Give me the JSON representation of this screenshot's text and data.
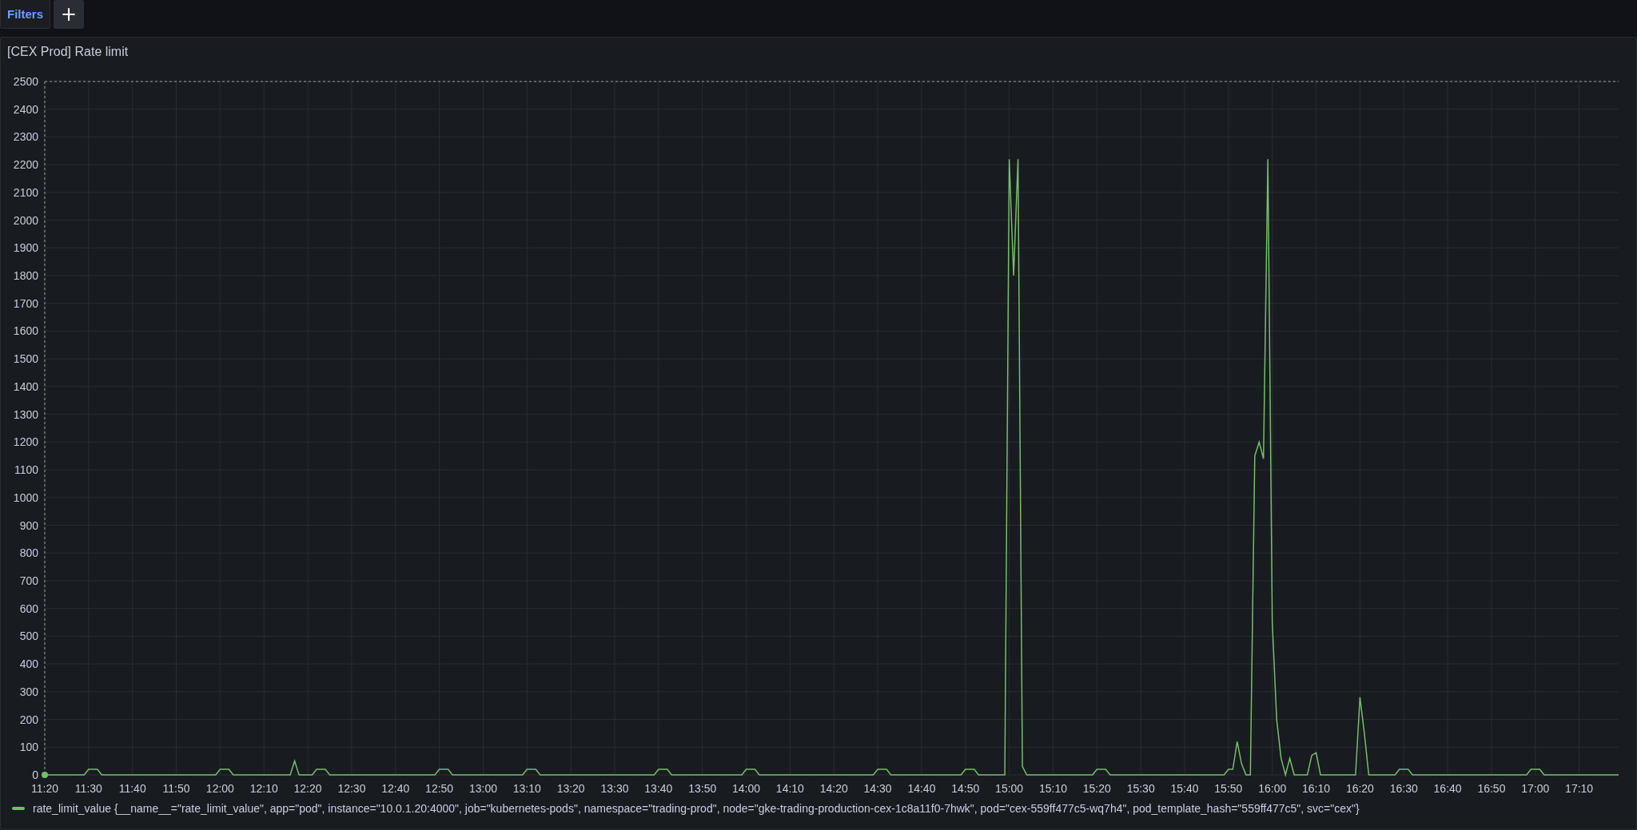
{
  "toolbar": {
    "filters_button": "Filters",
    "add_button": "+"
  },
  "panel": {
    "title": "[CEX Prod] Rate limit",
    "chart_data": {
      "type": "line",
      "grid": true,
      "ylim": [
        0,
        2500
      ],
      "yticks": [
        0,
        100,
        200,
        300,
        400,
        500,
        600,
        700,
        800,
        900,
        1000,
        1100,
        1200,
        1300,
        1400,
        1500,
        1600,
        1700,
        1800,
        1900,
        2000,
        2100,
        2200,
        2300,
        2400,
        2500
      ],
      "categories": [
        "11:20",
        null,
        null,
        null,
        null,
        null,
        null,
        null,
        null,
        null,
        "11:30",
        null,
        null,
        null,
        null,
        null,
        null,
        null,
        null,
        null,
        "11:40",
        null,
        null,
        null,
        null,
        null,
        null,
        null,
        null,
        null,
        "11:50",
        null,
        null,
        null,
        null,
        null,
        null,
        null,
        null,
        null,
        "12:00",
        null,
        null,
        null,
        null,
        null,
        null,
        null,
        null,
        null,
        "12:10",
        null,
        null,
        null,
        null,
        null,
        null,
        null,
        null,
        null,
        "12:20",
        null,
        null,
        null,
        null,
        null,
        null,
        null,
        null,
        null,
        "12:30",
        null,
        null,
        null,
        null,
        null,
        null,
        null,
        null,
        null,
        "12:40",
        null,
        null,
        null,
        null,
        null,
        null,
        null,
        null,
        null,
        "12:50",
        null,
        null,
        null,
        null,
        null,
        null,
        null,
        null,
        null,
        "13:00",
        null,
        null,
        null,
        null,
        null,
        null,
        null,
        null,
        null,
        "13:10",
        null,
        null,
        null,
        null,
        null,
        null,
        null,
        null,
        null,
        "13:20",
        null,
        null,
        null,
        null,
        null,
        null,
        null,
        null,
        null,
        "13:30",
        null,
        null,
        null,
        null,
        null,
        null,
        null,
        null,
        null,
        "13:40",
        null,
        null,
        null,
        null,
        null,
        null,
        null,
        null,
        null,
        "13:50",
        null,
        null,
        null,
        null,
        null,
        null,
        null,
        null,
        null,
        "14:00",
        null,
        null,
        null,
        null,
        null,
        null,
        null,
        null,
        null,
        "14:10",
        null,
        null,
        null,
        null,
        null,
        null,
        null,
        null,
        null,
        "14:20",
        null,
        null,
        null,
        null,
        null,
        null,
        null,
        null,
        null,
        "14:30",
        null,
        null,
        null,
        null,
        null,
        null,
        null,
        null,
        null,
        "14:40",
        null,
        null,
        null,
        null,
        null,
        null,
        null,
        null,
        null,
        "14:50",
        null,
        null,
        null,
        null,
        null,
        null,
        null,
        null,
        null,
        "15:00",
        null,
        null,
        null,
        null,
        null,
        null,
        null,
        null,
        null,
        "15:10",
        null,
        null,
        null,
        null,
        null,
        null,
        null,
        null,
        null,
        "15:20",
        null,
        null,
        null,
        null,
        null,
        null,
        null,
        null,
        null,
        "15:30",
        null,
        null,
        null,
        null,
        null,
        null,
        null,
        null,
        null,
        "15:40",
        null,
        null,
        null,
        null,
        null,
        null,
        null,
        null,
        null,
        "15:50",
        null,
        null,
        null,
        null,
        null,
        null,
        null,
        null,
        null,
        "16:00",
        null,
        null,
        null,
        null,
        null,
        null,
        null,
        null,
        null,
        "16:10",
        null,
        null,
        null,
        null,
        null,
        null,
        null,
        null,
        null,
        "16:20",
        null,
        null,
        null,
        null,
        null,
        null,
        null,
        null,
        null,
        "16:30",
        null,
        null,
        null,
        null,
        null,
        null,
        null,
        null,
        null,
        "16:40",
        null,
        null,
        null,
        null,
        null,
        null,
        null,
        null,
        null,
        "16:50",
        null,
        null,
        null,
        null,
        null,
        null,
        null,
        null,
        null,
        "17:00",
        null,
        null,
        null,
        null,
        null,
        null,
        null,
        null,
        null,
        "17:10",
        null,
        null,
        null,
        null,
        null,
        null,
        null,
        null,
        null
      ],
      "series": [
        {
          "name": "rate_limit_value {__name__=\"rate_limit_value\", app=\"pod\", instance=\"10.0.1.20:4000\", job=\"kubernetes-pods\", namespace=\"trading-prod\", node=\"gke-trading-production-cex-1c8a11f0-7hwk\", pod=\"cex-559ff477c5-wq7h4\", pod_template_hash=\"559ff477c5\", svc=\"cex\"}",
          "color": "#73bf69",
          "values": [
            0,
            0,
            0,
            0,
            0,
            0,
            0,
            0,
            0,
            0,
            20,
            20,
            20,
            0,
            0,
            0,
            0,
            0,
            0,
            0,
            0,
            0,
            0,
            0,
            0,
            0,
            0,
            0,
            0,
            0,
            0,
            0,
            0,
            0,
            0,
            0,
            0,
            0,
            0,
            0,
            20,
            20,
            20,
            0,
            0,
            0,
            0,
            0,
            0,
            0,
            0,
            0,
            0,
            0,
            0,
            0,
            0,
            50,
            0,
            0,
            0,
            0,
            20,
            20,
            20,
            0,
            0,
            0,
            0,
            0,
            0,
            0,
            0,
            0,
            0,
            0,
            0,
            0,
            0,
            0,
            0,
            0,
            0,
            0,
            0,
            0,
            0,
            0,
            0,
            0,
            20,
            20,
            20,
            0,
            0,
            0,
            0,
            0,
            0,
            0,
            0,
            0,
            0,
            0,
            0,
            0,
            0,
            0,
            0,
            0,
            20,
            20,
            20,
            0,
            0,
            0,
            0,
            0,
            0,
            0,
            0,
            0,
            0,
            0,
            0,
            0,
            0,
            0,
            0,
            0,
            0,
            0,
            0,
            0,
            0,
            0,
            0,
            0,
            0,
            0,
            20,
            20,
            20,
            0,
            0,
            0,
            0,
            0,
            0,
            0,
            0,
            0,
            0,
            0,
            0,
            0,
            0,
            0,
            0,
            0,
            20,
            20,
            20,
            0,
            0,
            0,
            0,
            0,
            0,
            0,
            0,
            0,
            0,
            0,
            0,
            0,
            0,
            0,
            0,
            0,
            0,
            0,
            0,
            0,
            0,
            0,
            0,
            0,
            0,
            0,
            20,
            20,
            20,
            0,
            0,
            0,
            0,
            0,
            0,
            0,
            0,
            0,
            0,
            0,
            0,
            0,
            0,
            0,
            0,
            0,
            20,
            20,
            20,
            0,
            0,
            0,
            0,
            0,
            0,
            0,
            2220,
            1800,
            2220,
            30,
            0,
            0,
            0,
            0,
            0,
            0,
            0,
            0,
            0,
            0,
            0,
            0,
            0,
            0,
            0,
            0,
            20,
            20,
            20,
            0,
            0,
            0,
            0,
            0,
            0,
            0,
            0,
            0,
            0,
            0,
            0,
            0,
            0,
            0,
            0,
            0,
            0,
            0,
            0,
            0,
            0,
            0,
            0,
            0,
            0,
            0,
            20,
            20,
            120,
            40,
            0,
            0,
            1150,
            1200,
            1140,
            2220,
            550,
            200,
            60,
            0,
            60,
            0,
            0,
            0,
            0,
            70,
            80,
            0,
            0,
            0,
            0,
            0,
            0,
            0,
            0,
            0,
            280,
            150,
            0,
            0,
            0,
            0,
            0,
            0,
            0,
            20,
            20,
            20,
            0,
            0,
            0,
            0,
            0,
            0,
            0,
            0,
            0,
            0,
            0,
            0,
            0,
            0,
            0,
            0,
            0,
            0,
            0,
            0,
            0,
            0,
            0,
            0,
            0,
            0,
            0,
            20,
            20,
            20,
            0,
            0,
            0,
            0,
            0,
            0,
            0,
            0,
            0,
            0,
            0,
            0,
            0,
            0,
            0,
            0,
            0,
            0
          ]
        }
      ]
    }
  }
}
